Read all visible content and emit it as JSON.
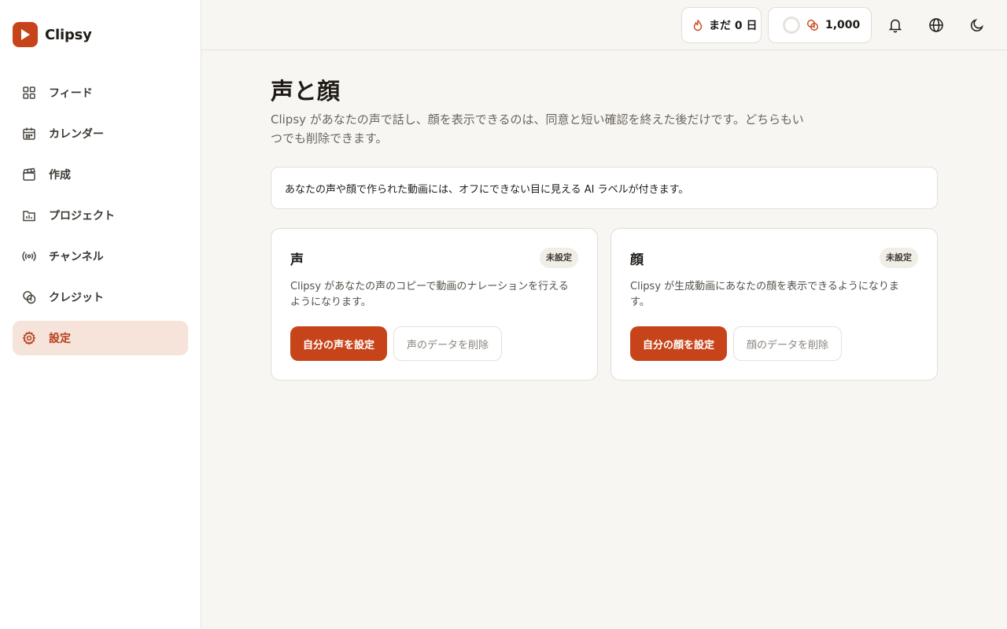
{
  "app": {
    "name": "Clipsy",
    "accent_color": "#c7441b",
    "active_bg": "#f6e3da"
  },
  "sidebar": {
    "items": [
      {
        "label": "フィード",
        "icon": "grid-icon",
        "active": false
      },
      {
        "label": "カレンダー",
        "icon": "calendar-icon",
        "active": false
      },
      {
        "label": "作成",
        "icon": "clapperboard-icon",
        "active": false
      },
      {
        "label": "プロジェクト",
        "icon": "folder-chart-icon",
        "active": false
      },
      {
        "label": "チャンネル",
        "icon": "broadcast-icon",
        "active": false
      },
      {
        "label": "クレジット",
        "icon": "coins-icon",
        "active": false
      },
      {
        "label": "設定",
        "icon": "gear-icon",
        "active": true
      }
    ]
  },
  "topbar": {
    "streak_label": "まだ 0 日",
    "credits_label": "1,000",
    "icons": [
      "bell-icon",
      "globe-icon",
      "moon-icon"
    ]
  },
  "main": {
    "title": "声と顔",
    "subtitle": "Clipsy があなたの声で話し、顔を表示できるのは、同意と短い確認を終えた後だけです。どちらもいつでも削除できます。",
    "notice": "あなたの声や顔で作られた動画には、オフにできない目に見える AI ラベルが付きます。",
    "cards": [
      {
        "title": "声",
        "badge": "未設定",
        "description": "Clipsy があなたの声のコピーで動画のナレーションを行えるようになります。",
        "primary_label": "自分の声を設定",
        "secondary_label": "声のデータを削除"
      },
      {
        "title": "顔",
        "badge": "未設定",
        "description": "Clipsy が生成動画にあなたの顔を表示できるようになります。",
        "primary_label": "自分の顔を設定",
        "secondary_label": "顔のデータを削除"
      }
    ]
  }
}
